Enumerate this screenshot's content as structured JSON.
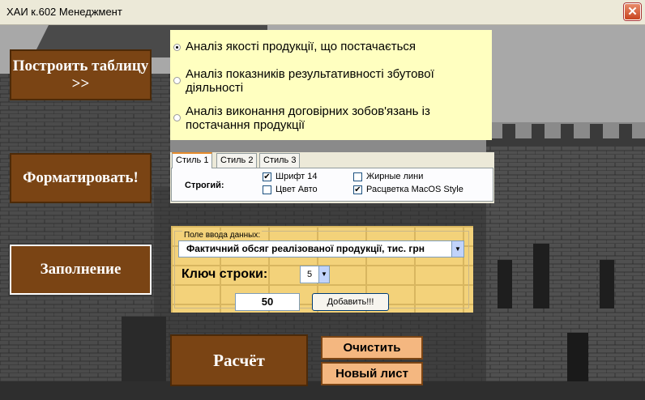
{
  "window": {
    "title": "ХАИ к.602 Менеджмент",
    "close_label": "✕"
  },
  "buttons": {
    "build_table": "Построить таблицу >>",
    "format": "Форматировать!",
    "fill": "Заполнение",
    "calculate": "Расчёт",
    "clear": "Очистить",
    "new_sheet": "Новый лист"
  },
  "radio_options": [
    {
      "label": "Аналіз якості продукції, що постачається",
      "checked": true
    },
    {
      "label": "Аналіз показників результативності збутової діяльності",
      "checked": false
    },
    {
      "label": "Аналіз виконання договірних зобов'язань із постачання продукції",
      "checked": false
    }
  ],
  "style_tabs": {
    "tabs": [
      "Стиль 1",
      "Стиль 2",
      "Стиль 3"
    ],
    "active_tab": "Стиль 1",
    "group_label": "Строгий:",
    "checkboxes": [
      {
        "label": "Шрифт 14",
        "checked": true
      },
      {
        "label": "Жирные лини",
        "checked": false
      },
      {
        "label": "Цвет Авто",
        "checked": false
      },
      {
        "label": "Расцветка MacOS Style",
        "checked": true
      }
    ]
  },
  "data_input": {
    "legend": "Поле ввода данных:",
    "combo_value": "Фактичний обсяг реалізованої продукції, тис. грн",
    "key_label": "Ключ строки:",
    "key_value": "5",
    "value": "50",
    "add_button": "Добавить!!!"
  },
  "colors": {
    "brown_button": "#7a4414",
    "orange_button": "#f4b780",
    "radio_panel": "#ffffc0",
    "input_panel": "#f3d27a"
  }
}
